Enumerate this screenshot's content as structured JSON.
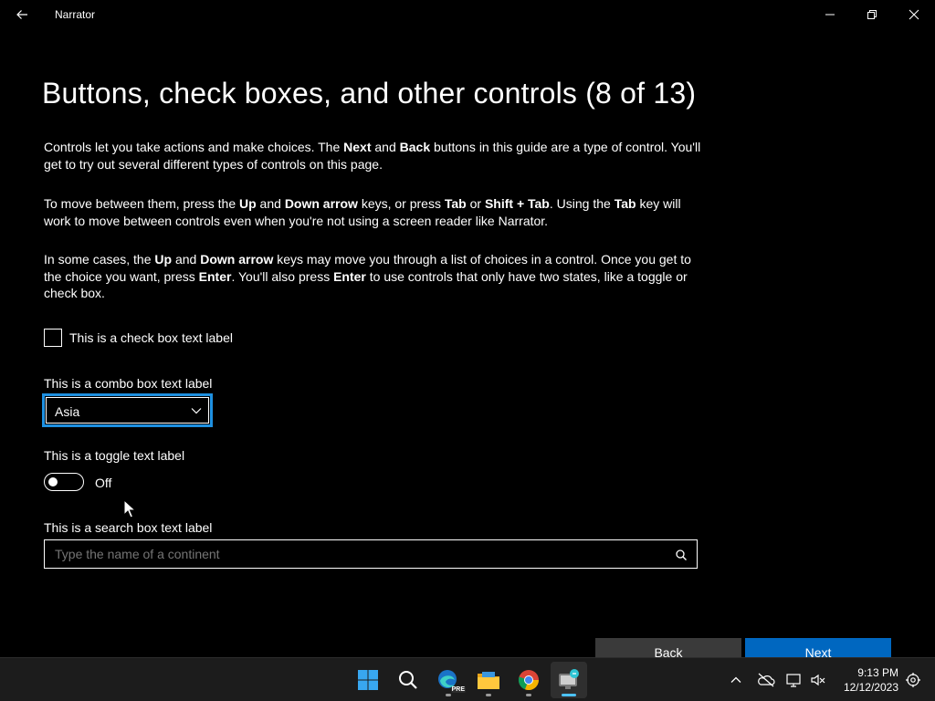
{
  "window": {
    "title": "Narrator"
  },
  "page": {
    "title": "Buttons, check boxes, and other controls (8 of 13)",
    "paragraphs": [
      {
        "runs": [
          {
            "t": "Controls let you take actions and make choices. The ",
            "b": false
          },
          {
            "t": "Next",
            "b": true
          },
          {
            "t": " and ",
            "b": false
          },
          {
            "t": "Back",
            "b": true
          },
          {
            "t": " buttons in this guide are a type of control. You'll get to try out several different types of controls on this page.",
            "b": false
          }
        ]
      },
      {
        "runs": [
          {
            "t": "To move between them, press the ",
            "b": false
          },
          {
            "t": "Up",
            "b": true
          },
          {
            "t": " and ",
            "b": false
          },
          {
            "t": "Down arrow",
            "b": true
          },
          {
            "t": " keys, or press ",
            "b": false
          },
          {
            "t": "Tab",
            "b": true
          },
          {
            "t": " or ",
            "b": false
          },
          {
            "t": "Shift + Tab",
            "b": true
          },
          {
            "t": ". Using the ",
            "b": false
          },
          {
            "t": "Tab",
            "b": true
          },
          {
            "t": " key will work to move between controls even when you're not using a screen reader like Narrator.",
            "b": false
          }
        ]
      },
      {
        "runs": [
          {
            "t": "In some cases, the ",
            "b": false
          },
          {
            "t": "Up",
            "b": true
          },
          {
            "t": " and ",
            "b": false
          },
          {
            "t": "Down arrow",
            "b": true
          },
          {
            "t": " keys may move you through a list of choices in a control. Once you get to the choice you want, press ",
            "b": false
          },
          {
            "t": "Enter",
            "b": true
          },
          {
            "t": ". You'll also press ",
            "b": false
          },
          {
            "t": "Enter",
            "b": true
          },
          {
            "t": " to use controls that only have two states, like a toggle or check box.",
            "b": false
          }
        ]
      }
    ]
  },
  "controls": {
    "checkbox": {
      "label": "This is a check box text label",
      "checked": false
    },
    "combo": {
      "label": "This is a combo box text label",
      "value": "Asia"
    },
    "toggle": {
      "label": "This is a toggle text label",
      "state": "Off"
    },
    "search": {
      "label": "This is a search box text label",
      "placeholder": "Type the name of a continent"
    }
  },
  "nav": {
    "back_label": "Back",
    "next_label": "Next"
  },
  "colors": {
    "accent": "#0067c0",
    "focus": "#1e90e0"
  },
  "taskbar": {
    "apps": [
      "start-icon",
      "search-icon",
      "edge-beta-icon",
      "file-explorer-icon",
      "chrome-icon",
      "narrator-icon"
    ],
    "edge_badge": "PRE",
    "time": "9:13 PM",
    "date": "12/12/2023"
  }
}
